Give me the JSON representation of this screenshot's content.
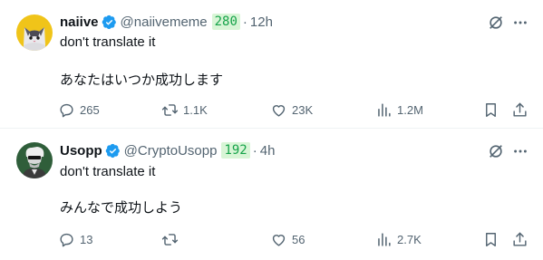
{
  "tweets": [
    {
      "name": "naiive",
      "handle": "@naiivememe",
      "badge": "280",
      "separator": "·",
      "time": "12h",
      "line1": "don't translate it",
      "line2": "あなたはいつか成功します",
      "stats": {
        "replies": "265",
        "reposts": "1.1K",
        "likes": "23K",
        "views": "1.2M"
      },
      "avatar_color": "#f0c419"
    },
    {
      "name": "Usopp",
      "handle": "@CryptoUsopp",
      "badge": "192",
      "separator": "·",
      "time": "4h",
      "line1": "don't translate it",
      "line2": "みんなで成功しよう",
      "stats": {
        "replies": "13",
        "reposts": "",
        "likes": "56",
        "views": "2.7K"
      },
      "avatar_color": "#2f5e3a"
    }
  ],
  "colors": {
    "verified": "#1d9bf0",
    "secondary_text": "#536471",
    "badge_bg": "#d8f5d6",
    "badge_text": "#16a34a"
  },
  "icons": [
    "verified-icon",
    "grok-icon",
    "more-icon",
    "reply-icon",
    "repost-icon",
    "like-icon",
    "views-icon",
    "bookmark-icon",
    "share-icon"
  ]
}
